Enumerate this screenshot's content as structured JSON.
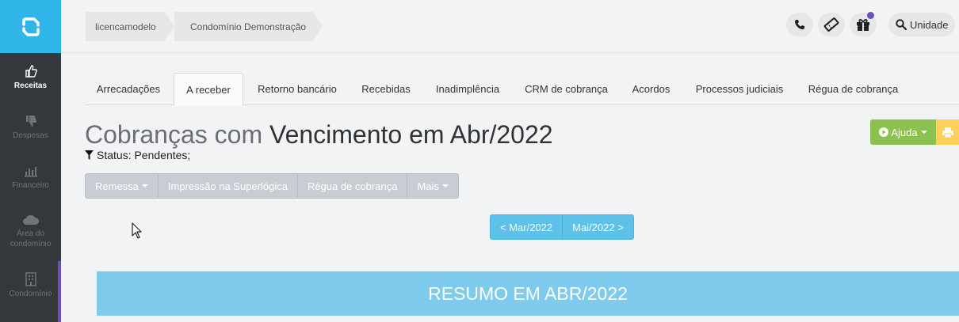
{
  "sidebar": {
    "items": [
      {
        "label": "Receitas",
        "icon": "thumbs-up-icon"
      },
      {
        "label": "Despesas",
        "icon": "thumbs-down-icon"
      },
      {
        "label": "Financeiro",
        "icon": "bar-chart-icon"
      },
      {
        "label": "Área do condomínio",
        "icon": "cloud-icon"
      },
      {
        "label": "Condomínio",
        "icon": "building-icon"
      }
    ]
  },
  "breadcrumb": {
    "items": [
      "licencamodelo",
      "Condomínio Demonstração"
    ]
  },
  "header": {
    "search_label": "Unidade"
  },
  "tabs": [
    "Arrecadações",
    "A receber",
    "Retorno bancário",
    "Recebidas",
    "Inadimplência",
    "CRM de cobrança",
    "Acordos",
    "Processos judiciais",
    "Régua de cobrança"
  ],
  "active_tab": "A receber",
  "page": {
    "title_light": "Cobranças com",
    "title_dark": "Vencimento em Abr/2022",
    "status": "Status: Pendentes;"
  },
  "actions": {
    "help_label": "Ajuda"
  },
  "toolbar": {
    "remessa": "Remessa",
    "impressao": "Impressão na Superlógica",
    "regua": "Régua de cobrança",
    "mais": "Mais"
  },
  "month_nav": {
    "prev": "< Mar/2022",
    "next": "Mai/2022 >"
  },
  "summary": {
    "title": "RESUMO EM ABR/2022"
  },
  "colors": {
    "brand": "#2fb5e8",
    "sidebar": "#34383c",
    "help": "#8cc152",
    "print": "#fcd05a",
    "summary": "#7ecbed",
    "notification": "#6b4fbb"
  }
}
